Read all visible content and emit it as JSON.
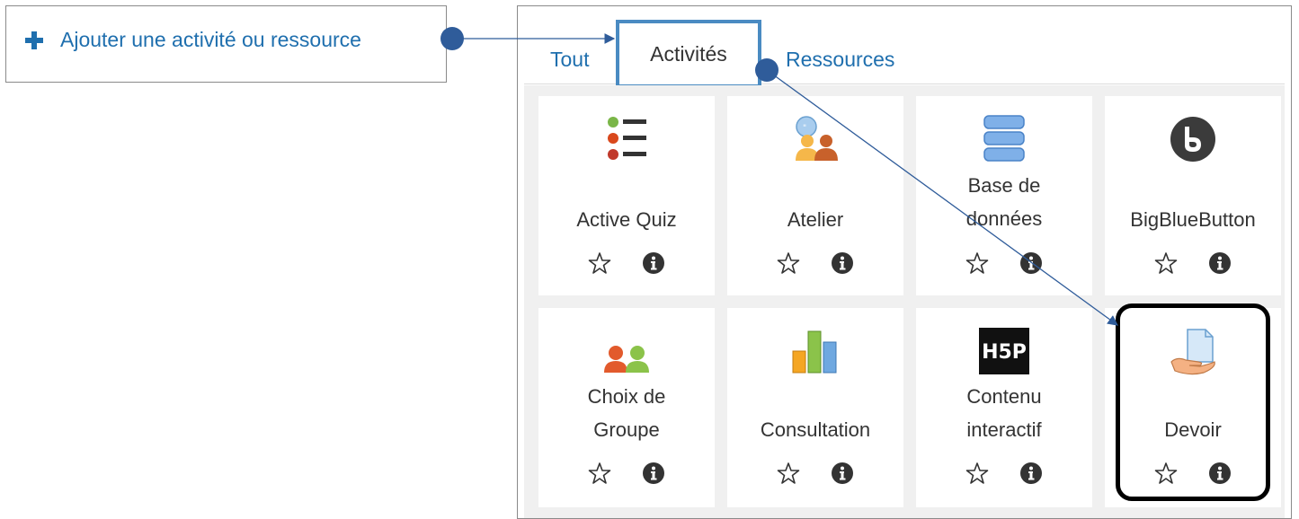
{
  "add_activity": {
    "label": "Ajouter une activité ou ressource"
  },
  "tabs": [
    {
      "label": "Tout"
    },
    {
      "label": "Activités"
    },
    {
      "label": "Ressources"
    }
  ],
  "activities": [
    {
      "label_lines": [
        "Active Quiz"
      ],
      "icon": "list-icon"
    },
    {
      "label_lines": [
        "Atelier"
      ],
      "icon": "workshop-icon"
    },
    {
      "label_lines": [
        "Base de",
        "données"
      ],
      "icon": "database-icon"
    },
    {
      "label_lines": [
        "BigBlueButton"
      ],
      "icon": "bigbluebutton-icon"
    },
    {
      "label_lines": [
        "Choix de",
        "Groupe"
      ],
      "icon": "group-choice-icon"
    },
    {
      "label_lines": [
        "Consultation"
      ],
      "icon": "bar-chart-icon"
    },
    {
      "label_lines": [
        "Contenu",
        "interactif"
      ],
      "icon": "h5p-icon"
    },
    {
      "label_lines": [
        "Devoir"
      ],
      "icon": "assignment-icon"
    }
  ],
  "colors": {
    "link": "#1f6fae",
    "annotation": "#2f5c9a",
    "highlight_tab_border": "#4a8bc2",
    "highlight_card_border": "#000000"
  }
}
